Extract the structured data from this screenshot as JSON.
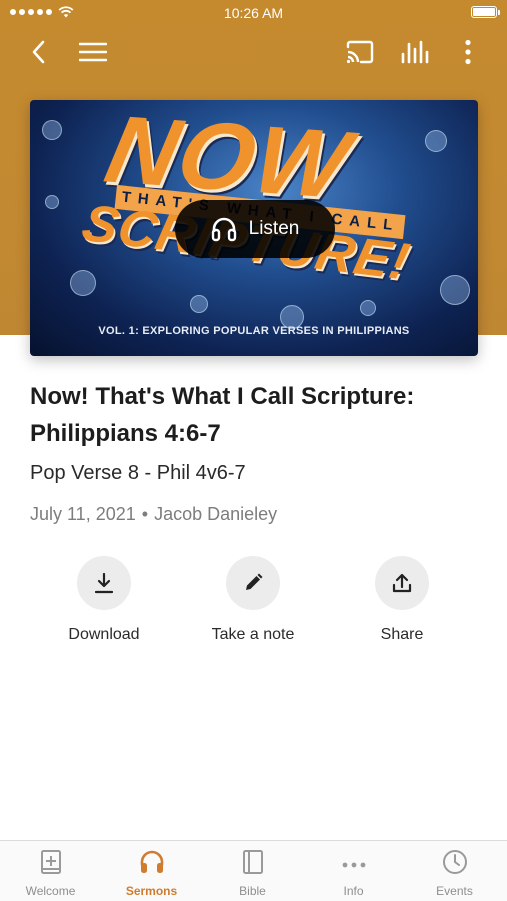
{
  "status_bar": {
    "time": "10:26 AM"
  },
  "artwork": {
    "headline": "NOW",
    "band_text": "THAT'S WHAT I CALL",
    "main_text": "SCRIPTURE!",
    "subtitle": "VOL. 1: EXPLORING POPULAR VERSES IN PHILIPPIANS",
    "listen_label": "Listen"
  },
  "sermon": {
    "title": "Now! That's What I Call Scripture: Philippians 4:6-7",
    "subtitle": "Pop Verse 8 - Phil 4v6-7",
    "date": "July 11, 2021",
    "speaker": "Jacob Danieley"
  },
  "actions": [
    {
      "label": "Download",
      "icon": "download-icon"
    },
    {
      "label": "Take a note",
      "icon": "pencil-icon"
    },
    {
      "label": "Share",
      "icon": "share-icon"
    }
  ],
  "tabs": [
    {
      "label": "Welcome",
      "icon": "book-plus-icon"
    },
    {
      "label": "Sermons",
      "icon": "headphones-icon",
      "active": true
    },
    {
      "label": "Bible",
      "icon": "bible-icon"
    },
    {
      "label": "Info",
      "icon": "ellipsis-icon"
    },
    {
      "label": "Events",
      "icon": "clock-icon"
    }
  ],
  "colors": {
    "accent": "#d07c2f",
    "header": "#c48a31"
  }
}
